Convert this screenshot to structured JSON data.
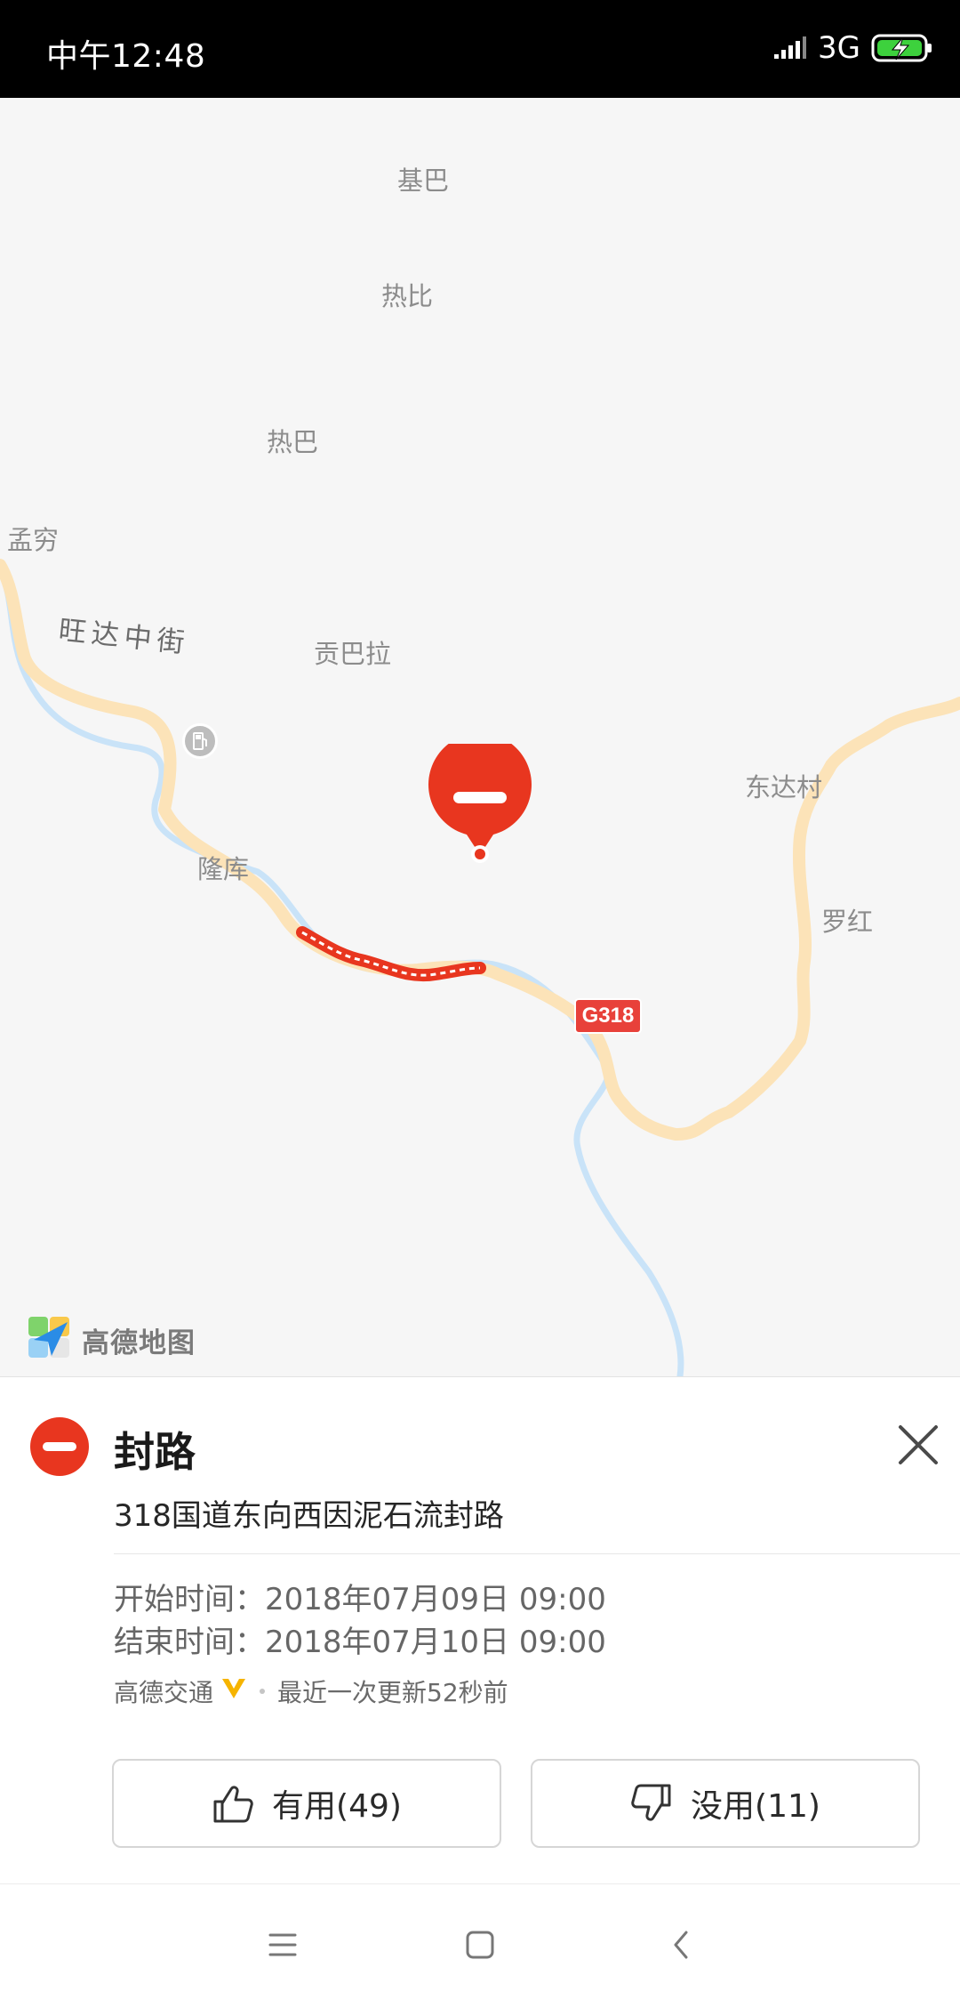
{
  "status_bar": {
    "time": "中午12:48",
    "network": "3G",
    "battery_color": "#3dd13d"
  },
  "map": {
    "places": [
      "基巴",
      "热比",
      "热巴",
      "孟穷",
      "贡巴拉",
      "隆库",
      "东达村",
      "罗红"
    ],
    "road_name": "旺达中街",
    "route_shield": "G318",
    "brand": "高德地图",
    "closure_color": "#e8361f"
  },
  "event": {
    "title": "封路",
    "description": "318国道东向西因泥石流封路",
    "start_time": "开始时间：2018年07月09日 09:00",
    "end_time": "结束时间：2018年07月10日 09:00",
    "source": "高德交通",
    "updated": "最近一次更新52秒前",
    "useful_label": "有用(49)",
    "useless_label": "没用(11)"
  },
  "icons": [
    "signal-icon",
    "battery-charging-icon",
    "gas-station-icon",
    "road-closed-icon",
    "close-icon",
    "thumbs-up-icon",
    "thumbs-down-icon",
    "menu-icon",
    "home-icon",
    "back-icon",
    "verified-v-icon",
    "amap-logo-icon"
  ]
}
